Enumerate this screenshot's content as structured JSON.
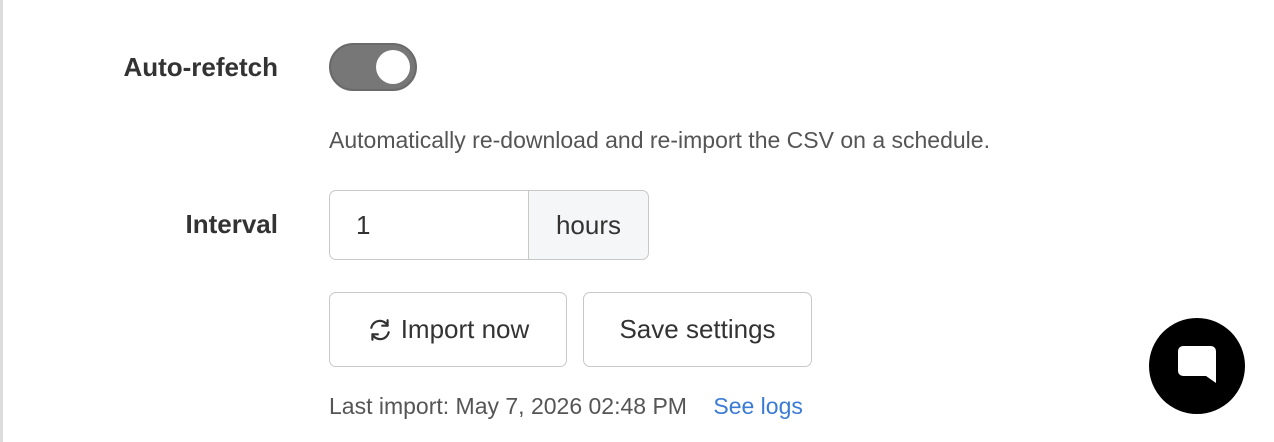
{
  "auto_refetch": {
    "label": "Auto-refetch",
    "enabled": true,
    "help_text": "Automatically re-download and re-import the CSV on a schedule."
  },
  "interval": {
    "label": "Interval",
    "value": "1",
    "unit": "hours"
  },
  "actions": {
    "import_label": "Import now",
    "save_label": "Save settings"
  },
  "status": {
    "last_import": "Last import: May 7, 2026 02:48 PM",
    "logs_link": "See logs"
  },
  "icons": {
    "import": "refresh-icon",
    "chat": "chat-bubble-icon"
  },
  "colors": {
    "toggle_on": "#777777",
    "link": "#3a7bd5",
    "chat_button": "#000000"
  }
}
